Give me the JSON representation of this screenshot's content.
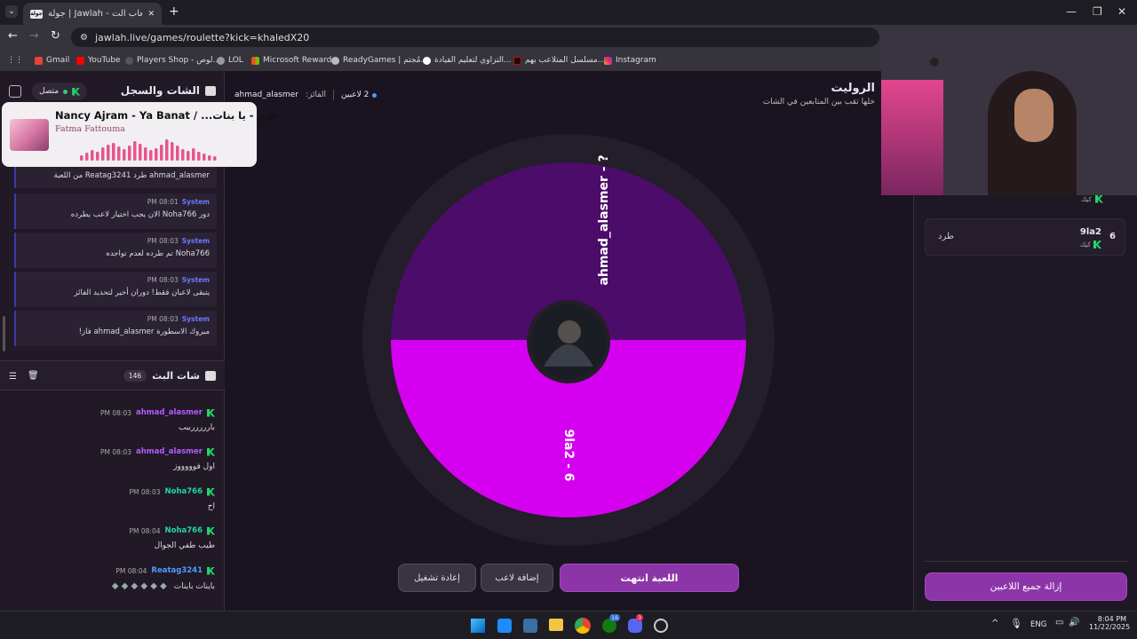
{
  "browser": {
    "tab_title": "جولة | Jawlah - منصة الألعاب الت...",
    "tab_fav_text": "جولة",
    "url": "jawlah.live/games/roulette?kick=khaledX20",
    "bookmarks": [
      "Gmail",
      "YouTube",
      "Players Shop - لوص...",
      "LOL",
      "Microsoft Rewards",
      "ReadyGames | مُجتم...",
      "التزاوي لتعليم القيادة...",
      "مسلسل المتلاعب بهم...",
      "Instagram"
    ],
    "colors": {
      "tab_bg": "#35333b",
      "frame": "#1f1d24"
    }
  },
  "left": {
    "log_title": "الشات والسجل",
    "status": "متصل",
    "music": {
      "track": "Nancy Ajram - Ya Banat / ...جرم - يا بنات",
      "artist": "Fatma Fattouma"
    },
    "log_partial": "ahmad_alasmer طرد Reatag3241 من اللعبة",
    "log": [
      {
        "sender": "System",
        "time": "08:01 PM",
        "text": "دور Noha766 الان يجب اختيار لاعب يطرده"
      },
      {
        "sender": "System",
        "time": "08:03 PM",
        "text": "Noha766 تم طرده لعدم تواجده"
      },
      {
        "sender": "System",
        "time": "08:03 PM",
        "text": "يتبقى لاعبان فقط! دوران أخير لتحديد الفائز"
      },
      {
        "sender": "System",
        "time": "08:03 PM",
        "text": "مبروك الاسطورة ahmad_alasmer فاز!"
      }
    ],
    "stream_chat_title": "شات البث",
    "stream_count": "146",
    "chat": [
      {
        "user": "ahmad_alasmer",
        "time": "08:03 PM",
        "text": "بارررررببب",
        "color": "#b45cff"
      },
      {
        "user": "ahmad_alasmer",
        "time": "08:03 PM",
        "text": "اول فوووووز",
        "color": "#b45cff"
      },
      {
        "user": "Noha766",
        "time": "08:03 PM",
        "text": "اح",
        "color": "#22d6a0"
      },
      {
        "user": "Noha766",
        "time": "08:04 PM",
        "text": "طيب طفي الجوال",
        "color": "#22d6a0"
      },
      {
        "user": "Reatag3241",
        "time": "08:04 PM",
        "text": "باينات باينات",
        "color": "#4a9dff"
      }
    ]
  },
  "center": {
    "title": "الروليت",
    "subtitle": "خلها تقب بين المتابعين في الشات",
    "winner_label": "الفائز:",
    "winner": "ahmad_alasmer",
    "players": "2 لاعبين",
    "wheel": {
      "slice_top": "ahmad_alasmer - ?",
      "slice_bottom": "9la2 - 6",
      "color_top": "#4c0c6a",
      "color_bottom": "#d600f0"
    },
    "buttons": {
      "game_over": "اللعبة انتهت",
      "add_player": "إضافة لاعب",
      "restart": "إعادة تشغيل"
    }
  },
  "right": {
    "player": {
      "rank": "6",
      "name": "9la2",
      "tag": "كيك",
      "action": "طرد"
    },
    "tag_above": "كيك",
    "remove_all": "إزالة جميع اللاعبين"
  },
  "taskbar": {
    "lang": "ENG",
    "time": "8:04 PM",
    "date": "11/22/2025",
    "badge_edge": "16",
    "badge_discord": "3"
  }
}
